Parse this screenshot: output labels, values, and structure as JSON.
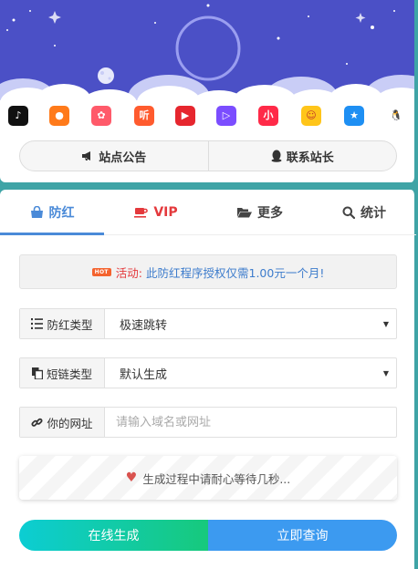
{
  "apps": [
    {
      "name": "tiktok-icon",
      "color": "#111111",
      "glyph": "♪"
    },
    {
      "name": "kuaishou-icon",
      "color": "#ff7a1a",
      "glyph": "●"
    },
    {
      "name": "bird-app-icon",
      "color": "#ff5a6a",
      "glyph": "✿"
    },
    {
      "name": "listen-app-icon",
      "color": "#ff5b2e",
      "glyph": "听"
    },
    {
      "name": "video-play-icon",
      "color": "#e6262e",
      "glyph": "▶"
    },
    {
      "name": "purple-video-icon",
      "color": "#7b4dff",
      "glyph": "▷"
    },
    {
      "name": "xiaohongshu-icon",
      "color": "#ff2a48",
      "glyph": "小"
    },
    {
      "name": "yellow-face-icon",
      "color": "#ffc51a",
      "glyph": "☺"
    },
    {
      "name": "star-app-icon",
      "color": "#1e8ff3",
      "glyph": "★"
    },
    {
      "name": "qq-penguin-icon",
      "color": "#ffffff",
      "glyph": "🐧"
    }
  ],
  "header": {
    "announcement_label": "站点公告",
    "contact_label": "联系站长"
  },
  "tabs": [
    {
      "label": "防红",
      "icon": "bag-icon",
      "active": true
    },
    {
      "label": "VIP",
      "icon": "coffee-cup-icon",
      "active": false
    },
    {
      "label": "更多",
      "icon": "folder-open-icon",
      "active": false
    },
    {
      "label": "统计",
      "icon": "search-icon",
      "active": false
    }
  ],
  "notice": {
    "badge": "HOT",
    "label": "活动:",
    "text": "此防红程序授权仅需1.00元一个月!"
  },
  "form": {
    "type_label": "防红类型",
    "type_value": "极速跳转",
    "short_label": "短链类型",
    "short_value": "默认生成",
    "url_label": "你的网址",
    "url_placeholder": "请输入域名或网址",
    "url_value": ""
  },
  "progress_text": "生成过程中请耐心等待几秒...",
  "buttons": {
    "generate": "在线生成",
    "query": "立即查询"
  },
  "colors": {
    "accent": "#4a8ad8",
    "vip": "#e4393c",
    "sky": "#4b50c6",
    "generate_start": "#0ccdd3",
    "generate_end": "#17c97c",
    "query": "#3c9af0"
  }
}
